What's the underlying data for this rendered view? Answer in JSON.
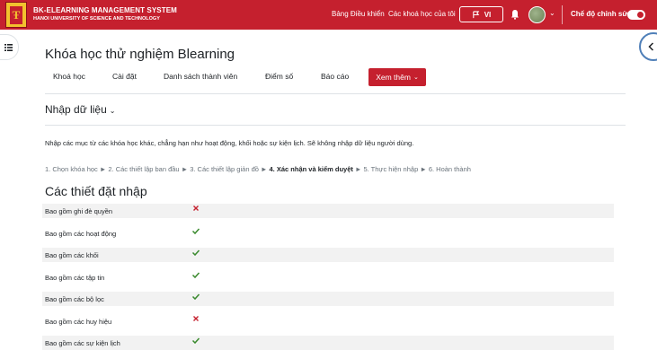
{
  "navbar": {
    "brand_title": "BK-ELEARNING MANAGEMENT SYSTEM",
    "brand_subtitle": "HANOI UNIVERSITY OF SCIENCE AND TECHNOLOGY",
    "links": [
      "Bảng Điều khiển",
      "Các khoá học của tôi"
    ],
    "language": "VI",
    "edit_mode_label": "Chế độ chỉnh sửa",
    "edit_mode_on": true,
    "brand_color": "#c5202e"
  },
  "page": {
    "title": "Khóa học thử nghiệm Blearning",
    "tabs": [
      "Khoá học",
      "Cài đặt",
      "Danh sách thành viên",
      "Điểm số",
      "Báo cáo"
    ],
    "more_label": "Xem thêm"
  },
  "import": {
    "heading": "Nhập dữ liệu",
    "description": "Nhập các mục từ các khóa học khác, chẳng hạn như hoạt động, khối hoặc sự kiện lịch. Sẽ không nhập dữ liệu người dùng.",
    "steps_before": "1. Chọn khóa học ► 2. Các thiết lập ban đầu ► 3. Các thiết lập giản đồ ► ",
    "step_current": "4. Xác nhận và kiểm duyệt",
    "steps_after": " ► 5. Thực hiện nhập ► 6. Hoàn thành",
    "settings_heading": "Các thiết đặt nhập",
    "settings": [
      {
        "label": "Bao gồm ghi đè quyền",
        "enabled": false,
        "icon": "cross-icon"
      },
      {
        "label": "Bao gồm các hoạt động",
        "enabled": true,
        "icon": "check-icon"
      },
      {
        "label": "Bao gồm các khối",
        "enabled": true,
        "icon": "check-icon"
      },
      {
        "label": "Bao gồm các tập tin",
        "enabled": true,
        "icon": "check-icon"
      },
      {
        "label": "Bao gồm các bộ lọc",
        "enabled": true,
        "icon": "check-icon"
      },
      {
        "label": "Bao gồm các huy hiệu",
        "enabled": false,
        "icon": "cross-icon"
      },
      {
        "label": "Bao gồm các sự kiện lịch",
        "enabled": true,
        "icon": "check-icon"
      }
    ]
  }
}
